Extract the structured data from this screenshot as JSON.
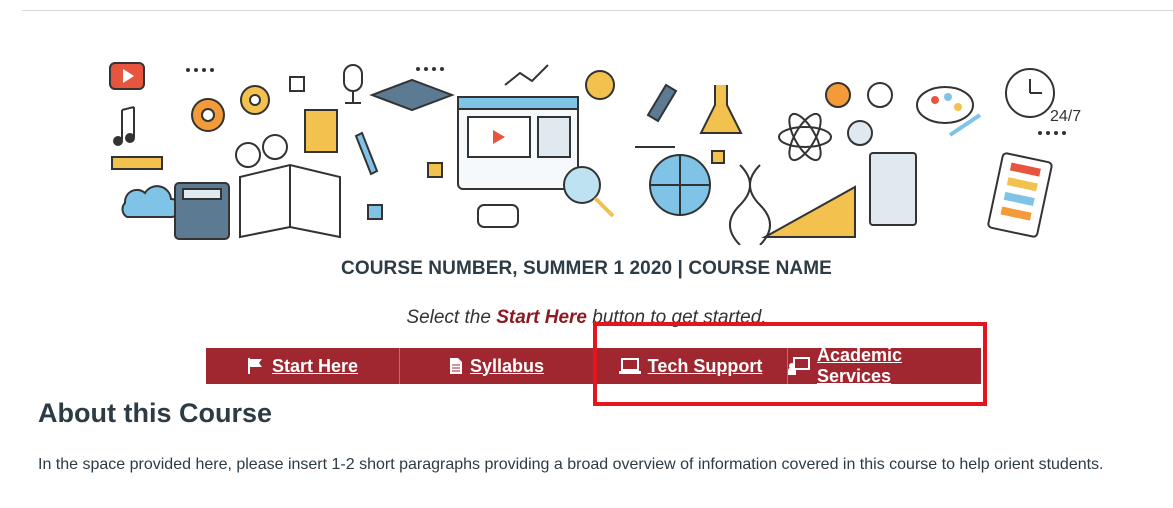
{
  "course": {
    "title": "COURSE NUMBER, SUMMER 1 2020 | COURSE NAME",
    "prompt_before": "Select the ",
    "prompt_emphasis": "Start Here",
    "prompt_after": " button to get started."
  },
  "nav": {
    "items": [
      {
        "label": "Start Here",
        "icon": "flag-icon"
      },
      {
        "label": "Syllabus",
        "icon": "document-icon"
      },
      {
        "label": "Tech Support",
        "icon": "laptop-icon"
      },
      {
        "label": "Academic Services",
        "icon": "presentation-icon"
      }
    ]
  },
  "about": {
    "heading": "About this Course",
    "body": "In the space provided here, please insert 1-2 short paragraphs providing a broad overview of information covered in this course to help orient students."
  },
  "banner": {
    "clock_label": "24/7"
  },
  "colors": {
    "nav_bg": "#a0272f",
    "highlight": "#e3161d",
    "emphasis": "#8b1a1f"
  }
}
